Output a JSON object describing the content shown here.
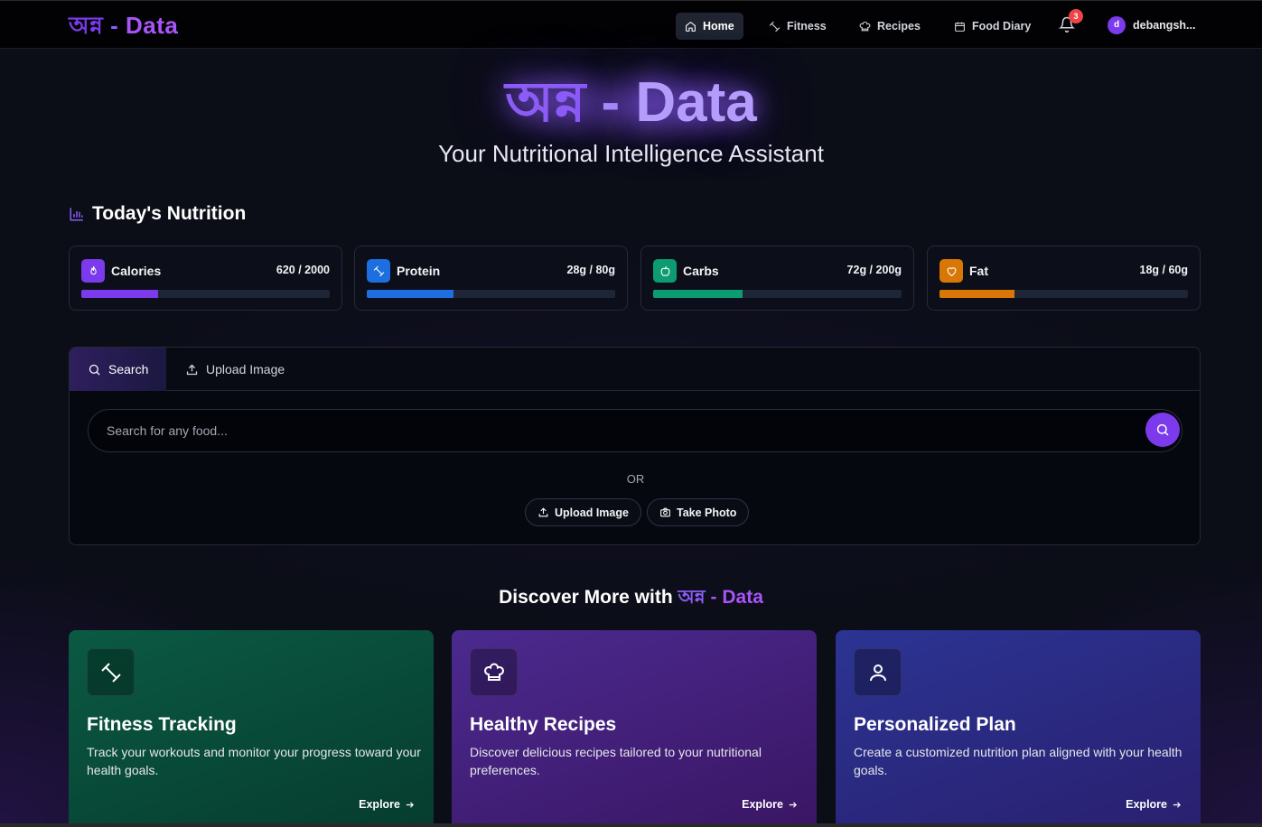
{
  "navbar": {
    "brand_bengali": "অন্ন",
    "brand_dash": " - ",
    "brand_data": "Data",
    "items": [
      {
        "label": "Home",
        "icon": "home-icon",
        "active": true
      },
      {
        "label": "Fitness",
        "icon": "dumbbell-icon",
        "active": false
      },
      {
        "label": "Recipes",
        "icon": "chef-hat-icon",
        "active": false
      },
      {
        "label": "Food Diary",
        "icon": "calendar-icon",
        "active": false
      }
    ],
    "notifications_count": "3",
    "user_initial": "d",
    "username": "debangsh..."
  },
  "hero": {
    "title_bengali": "অন্ন",
    "title_dash": " - ",
    "title_data": "Data",
    "subtitle": "Your Nutritional Intelligence Assistant"
  },
  "nutrition": {
    "title": "Today's Nutrition",
    "items": [
      {
        "label": "Calories",
        "value": "620 / 2000",
        "progress": 0.31,
        "color": "#7c3aed",
        "icon": "flame-icon"
      },
      {
        "label": "Protein",
        "value": "28g / 80g",
        "progress": 0.35,
        "color": "#1d6fe0",
        "icon": "dumbbell-icon"
      },
      {
        "label": "Carbs",
        "value": "72g / 200g",
        "progress": 0.36,
        "color": "#0d9b72",
        "icon": "apple-icon"
      },
      {
        "label": "Fat",
        "value": "18g / 60g",
        "progress": 0.3,
        "color": "#d97706",
        "icon": "heart-icon"
      }
    ]
  },
  "search_panel": {
    "tabs": [
      {
        "label": "Search",
        "icon": "search-icon",
        "active": true
      },
      {
        "label": "Upload Image",
        "icon": "upload-icon",
        "active": false
      }
    ],
    "search_placeholder": "Search for any food...",
    "or_text": "OR",
    "upload_button": "Upload Image",
    "take_photo_button": "Take Photo"
  },
  "discover": {
    "title_prefix": "Discover More with ",
    "title_bengali": "অন্ন",
    "title_dash": " - ",
    "title_data": "Data",
    "cards": [
      {
        "title": "Fitness Tracking",
        "description": "Track your workouts and monitor your progress toward your health goals.",
        "explore": "Explore",
        "icon": "dumbbell-icon"
      },
      {
        "title": "Healthy Recipes",
        "description": "Discover delicious recipes tailored to your nutritional preferences.",
        "explore": "Explore",
        "icon": "chef-hat-icon"
      },
      {
        "title": "Personalized Plan",
        "description": "Create a customized nutrition plan aligned with your health goals.",
        "explore": "Explore",
        "icon": "user-icon"
      }
    ]
  },
  "colors": {
    "accent": "#7c3aed",
    "background": "#0b0d17",
    "badge": "#ef4444"
  }
}
